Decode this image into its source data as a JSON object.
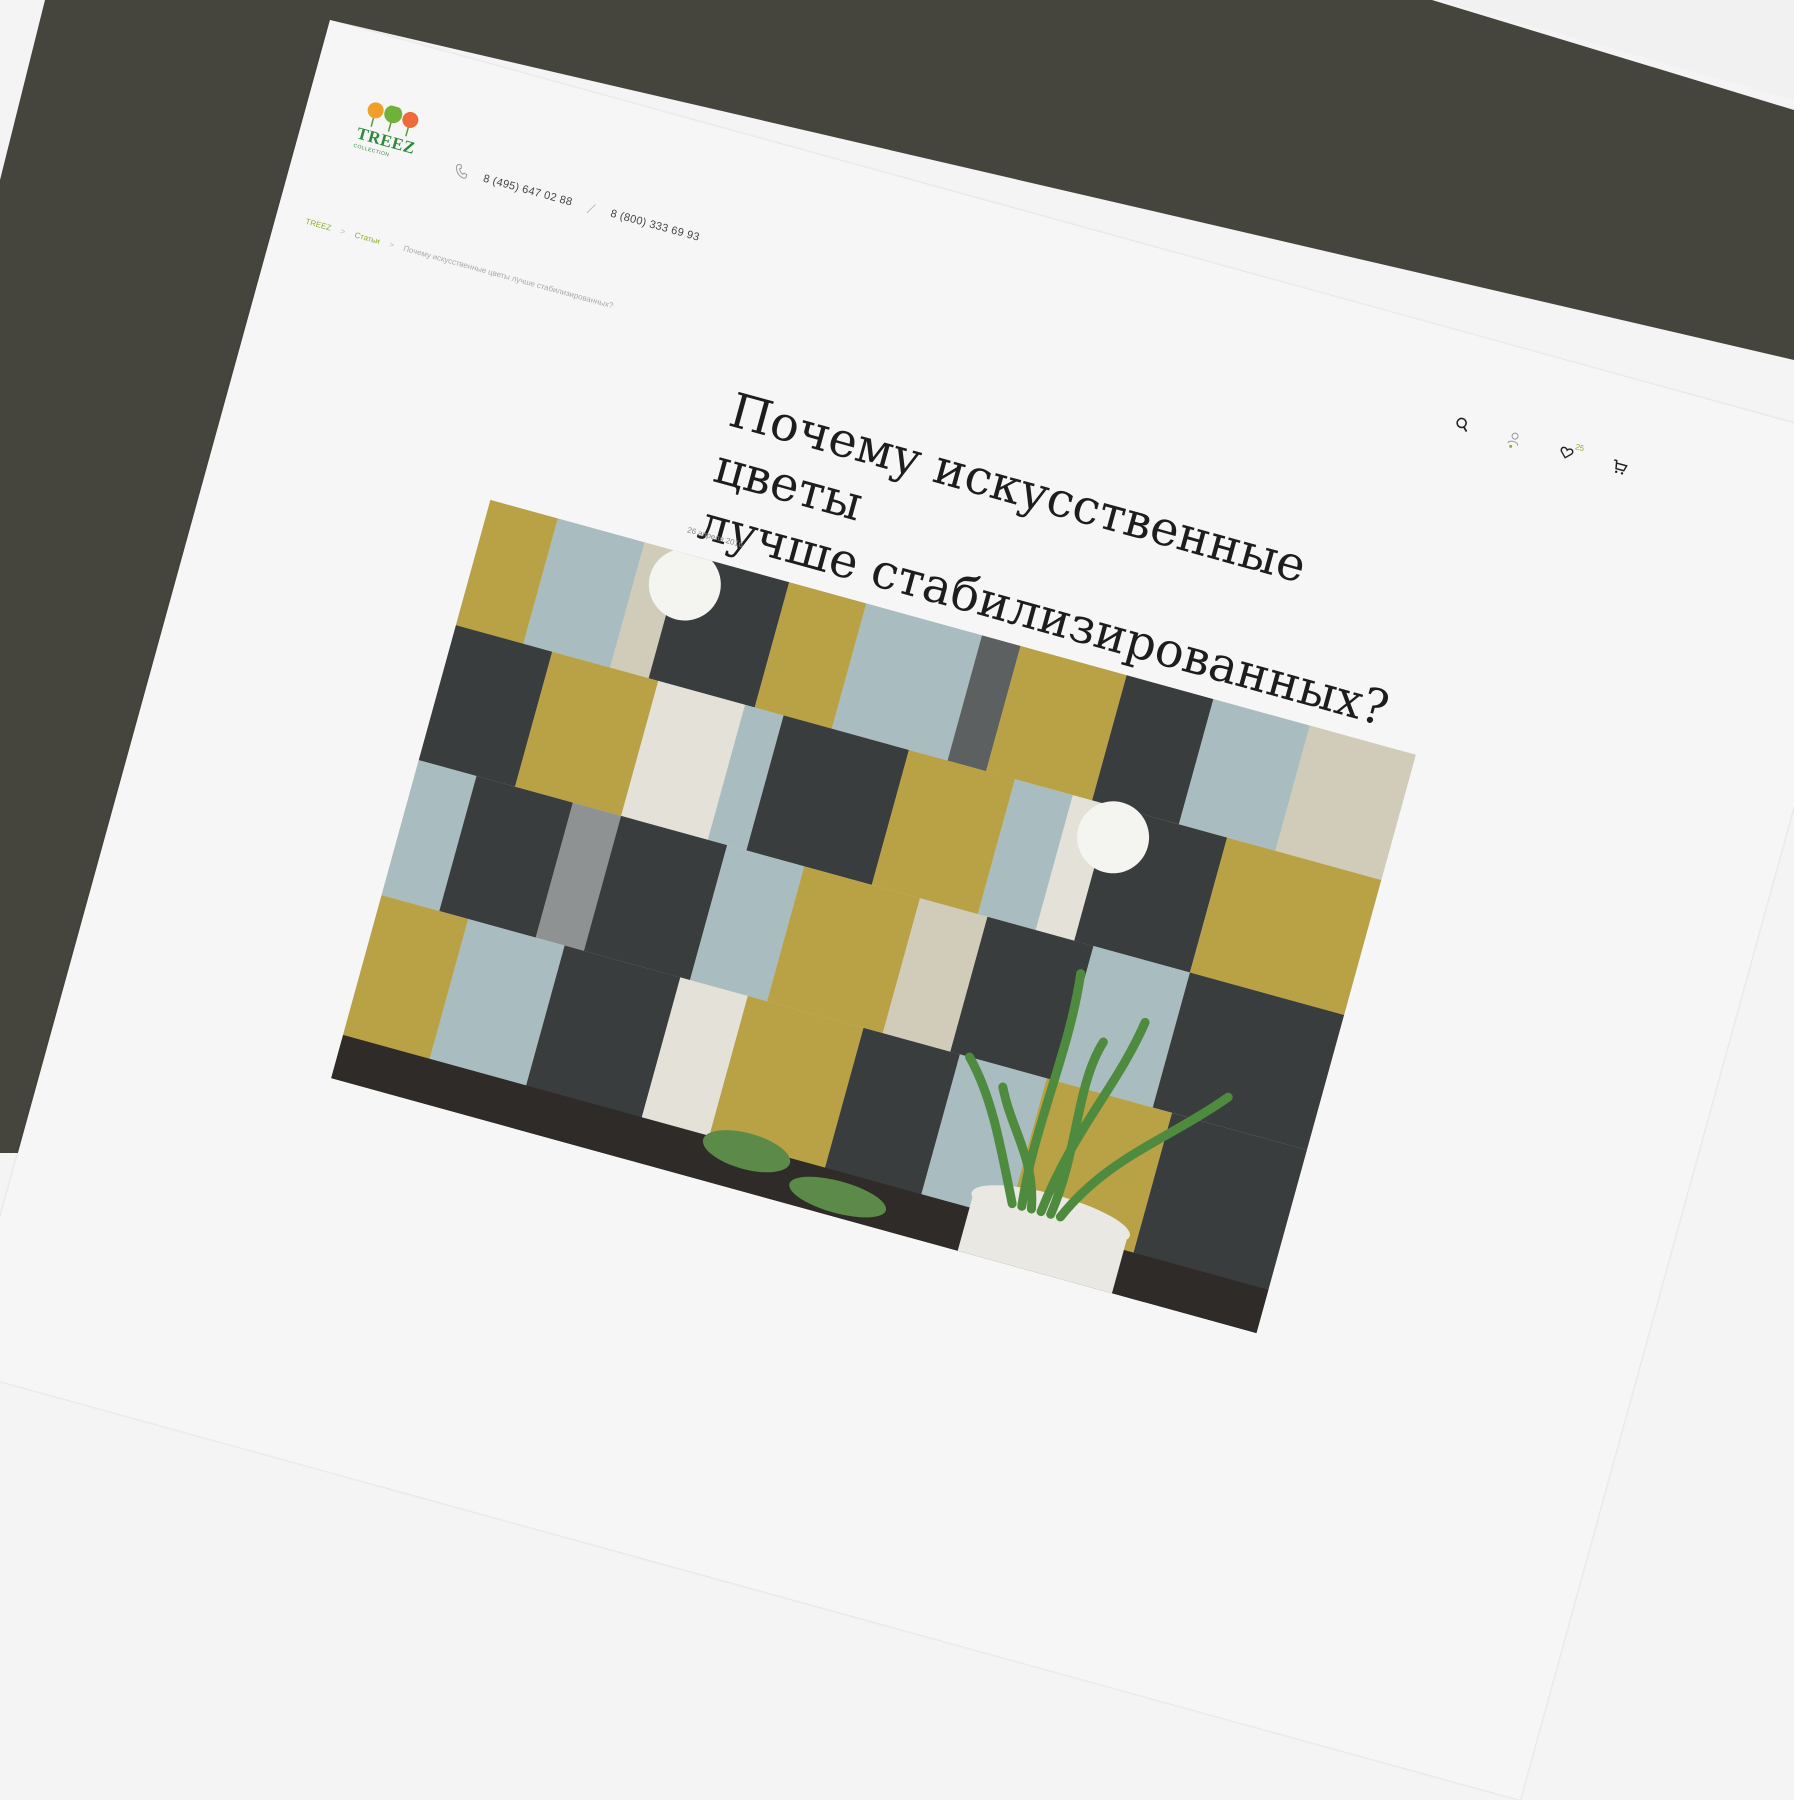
{
  "logo": {
    "text": "TREEZ",
    "subtext": "COLLECTION"
  },
  "header": {
    "phone_icon": "phone-icon",
    "phone_1": "8 (495) 647 02 88",
    "phone_2": "8 (800) 333 69 93"
  },
  "breadcrumb": {
    "home": "TREEZ",
    "section": "Статьи",
    "current": "Почему искусственные цветы лучше стабилизированных?"
  },
  "icons": [
    "search-icon",
    "user-icon",
    "heart-icon",
    "cart-icon"
  ],
  "favorites_count": "25",
  "article": {
    "title_line_1": "Почему искусственные цветы",
    "title_line_2": "лучше стабилизированных?",
    "date": "26 апреля 2016"
  },
  "colors": {
    "outer_dark": "#45443d",
    "page_bg": "#f6f6f6",
    "accent_green": "#8aae2e",
    "logo_green": "#2f8a3d",
    "mustard": "#b9a146",
    "slate": "#3a3d3e",
    "pale_blue": "#a9bdc0"
  }
}
